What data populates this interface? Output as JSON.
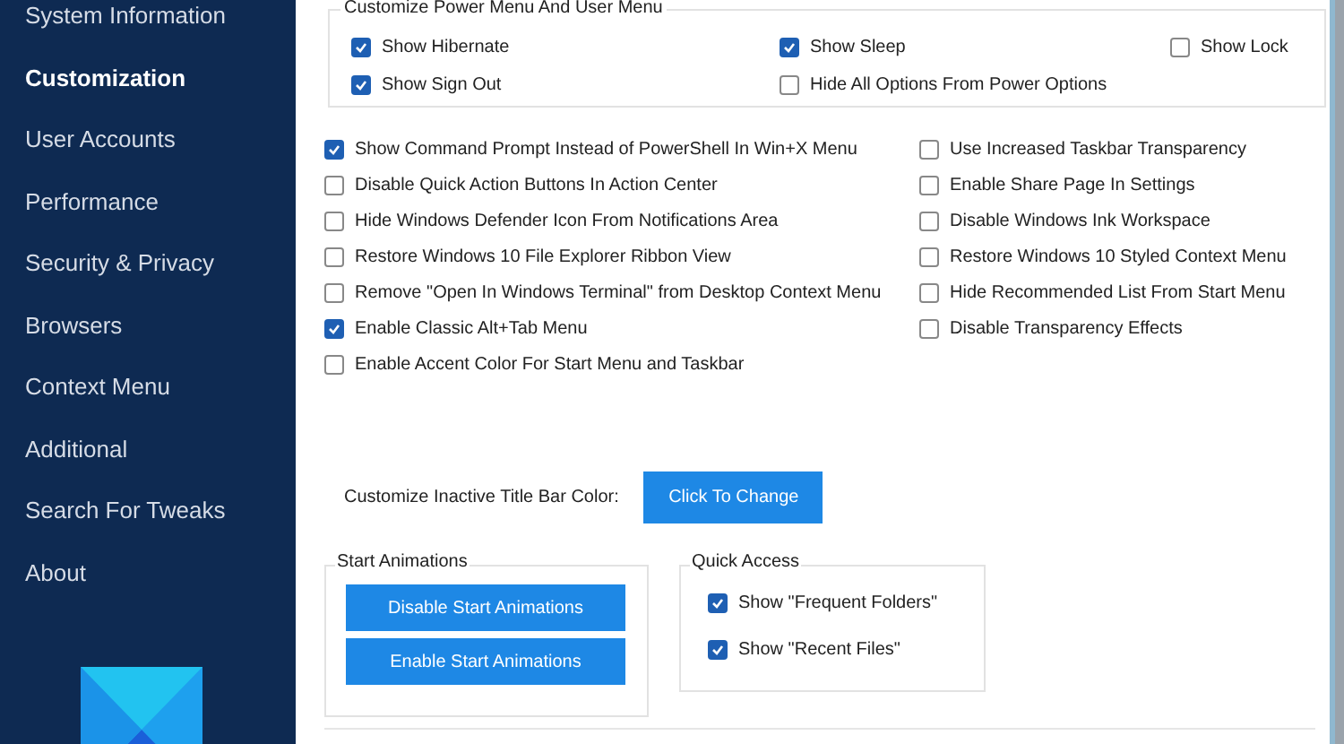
{
  "sidebar": {
    "items": [
      {
        "label": "System Information",
        "selected": false
      },
      {
        "label": "Customization",
        "selected": true
      },
      {
        "label": "User Accounts",
        "selected": false
      },
      {
        "label": "Performance",
        "selected": false
      },
      {
        "label": "Security & Privacy",
        "selected": false
      },
      {
        "label": "Browsers",
        "selected": false
      },
      {
        "label": "Context Menu",
        "selected": false
      },
      {
        "label": "Additional",
        "selected": false
      },
      {
        "label": "Search For Tweaks",
        "selected": false
      },
      {
        "label": "About",
        "selected": false
      }
    ]
  },
  "power_menu": {
    "title": "Customize Power Menu And User Menu",
    "options": [
      {
        "label": "Show Hibernate",
        "checked": true
      },
      {
        "label": "Show Sleep",
        "checked": true
      },
      {
        "label": "Show Lock",
        "checked": false
      },
      {
        "label": "Show Sign Out",
        "checked": true
      },
      {
        "label": "Hide All Options From Power Options",
        "checked": false
      }
    ]
  },
  "options_left": [
    {
      "label": "Show Command Prompt Instead of PowerShell In Win+X Menu",
      "checked": true
    },
    {
      "label": "Disable Quick Action Buttons In Action Center",
      "checked": false
    },
    {
      "label": "Hide Windows Defender Icon From Notifications Area",
      "checked": false
    },
    {
      "label": "Restore Windows 10 File Explorer Ribbon View",
      "checked": false
    },
    {
      "label": "Remove \"Open In Windows Terminal\" from Desktop Context Menu",
      "checked": false
    },
    {
      "label": "Enable Classic Alt+Tab Menu",
      "checked": true
    },
    {
      "label": "Enable Accent Color For Start Menu and Taskbar",
      "checked": false
    }
  ],
  "options_right": [
    {
      "label": "Use Increased Taskbar Transparency",
      "checked": false
    },
    {
      "label": "Enable Share Page In Settings",
      "checked": false
    },
    {
      "label": "Disable Windows Ink Workspace",
      "checked": false
    },
    {
      "label": "Restore Windows 10 Styled Context Menu",
      "checked": false
    },
    {
      "label": "Hide Recommended List From Start Menu",
      "checked": false
    },
    {
      "label": "Disable Transparency Effects",
      "checked": false
    }
  ],
  "title_bar_color": {
    "label": "Customize Inactive Title Bar Color:",
    "button": "Click To Change"
  },
  "start_animations": {
    "title": "Start Animations",
    "buttons": [
      "Disable Start Animations",
      "Enable Start Animations"
    ]
  },
  "quick_access": {
    "title": "Quick Access",
    "options": [
      {
        "label": "Show \"Frequent Folders\"",
        "checked": true
      },
      {
        "label": "Show \"Recent Files\"",
        "checked": true
      }
    ]
  }
}
